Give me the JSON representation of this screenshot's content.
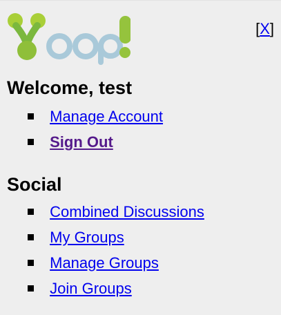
{
  "logo": {
    "text": "Yoop!"
  },
  "close_link": {
    "label": "X"
  },
  "welcome": {
    "heading": "Welcome, test",
    "items": [
      {
        "label": "Manage Account"
      },
      {
        "label": "Sign Out"
      }
    ]
  },
  "social": {
    "heading": "Social",
    "items": [
      {
        "label": "Combined Discussions"
      },
      {
        "label": "My Groups"
      },
      {
        "label": "Manage Groups"
      },
      {
        "label": "Join Groups"
      }
    ]
  }
}
